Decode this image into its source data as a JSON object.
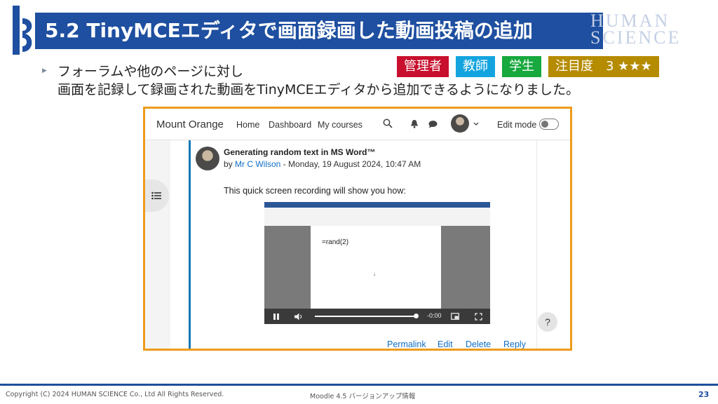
{
  "slide": {
    "title": "5.2 TinyMCEエディタで画面録画した動画投稿の追加",
    "brand_line1": "HUMAN",
    "brand_line2": "SCIENCE",
    "description_line1": "フォーラムや他のページに対し",
    "description_line2": "画面を記録して録画された動画をTinyMCEエディタから追加できるようになりました。",
    "badges": {
      "admin": "管理者",
      "teacher": "教師",
      "student": "学生",
      "attention": "注目度　3 ★★★"
    },
    "footer": {
      "copyright": "Copyright (C) 2024 HUMAN SCIENCE Co., Ltd All Rights Reserved.",
      "middle": "Moodle 4.5 バージョンアップ情報",
      "page_number": "23"
    },
    "colors": {
      "title_band": "#1e4fa0",
      "frame_border": "#ee9b1b",
      "badge_admin": "#c8102e",
      "badge_teacher": "#13a4e0",
      "badge_student": "#17a83e",
      "badge_attention": "#b58b00",
      "link": "#0f6fc5"
    }
  },
  "moodle": {
    "site_name": "Mount Orange",
    "nav": {
      "home": "Home",
      "dashboard": "Dashboard",
      "my_courses": "My courses"
    },
    "edit_mode_label": "Edit mode",
    "post": {
      "title": "Generating random text in MS Word™",
      "by": "by ",
      "author": "Mr C Wilson",
      "date": " - Monday, 19 August 2024, 10:47 AM",
      "body": "This quick screen recording will show you how:"
    },
    "video": {
      "doc_text": "=rand(2)",
      "time": "-0:00",
      "progress": 1.0
    },
    "actions": {
      "permalink": "Permalink",
      "edit": "Edit",
      "delete": "Delete",
      "reply": "Reply"
    },
    "help_label": "?"
  }
}
